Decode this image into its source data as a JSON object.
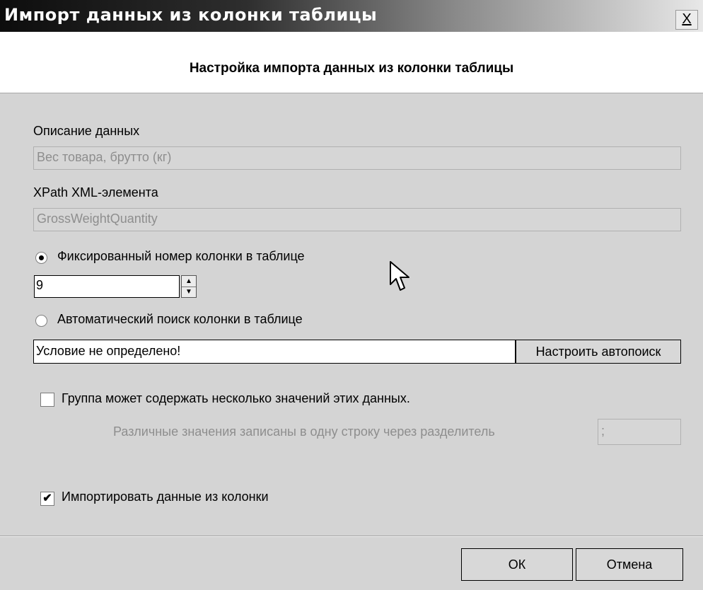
{
  "window": {
    "title": "Импорт данных из колонки таблицы",
    "close_label": "X"
  },
  "header": {
    "title": "Настройка импорта данных из колонки таблицы"
  },
  "form": {
    "description_label": "Описание данных",
    "description_value": "Вес товара, брутто (кг)",
    "xpath_label": "XPath XML-элемента",
    "xpath_value": "GrossWeightQuantity",
    "fixed_column_option": {
      "label": "Фиксированный номер колонки в таблице",
      "selected": true
    },
    "column_number": "9",
    "auto_search_option": {
      "label": "Автоматический поиск колонки в таблице",
      "selected": false
    },
    "condition_value": "Условие не определено!",
    "configure_autosearch_label": "Настроить автопоиск",
    "multi_value_checkbox": {
      "label": "Группа может содержать несколько значений этих данных.",
      "checked": false
    },
    "separator_label": "Различные значения записаны в одну строку через разделитель",
    "separator_value": ";",
    "import_checkbox": {
      "label": "Импортировать данные из колонки",
      "checked": true
    }
  },
  "footer": {
    "ok_label": "ОК",
    "cancel_label": "Отмена"
  },
  "icons": {
    "close": "close-icon",
    "spin_up": "spin-up-icon",
    "spin_down": "spin-down-icon",
    "checkmark": "checkmark-icon",
    "cursor": "mouse-cursor-icon"
  },
  "colors": {
    "titlebar_start": "#0d0d0d",
    "titlebar_end": "#e8e8e8",
    "dialog_bg": "#d4d4d4",
    "header_bg": "#ffffff",
    "disabled_text": "#8e8e8e"
  }
}
